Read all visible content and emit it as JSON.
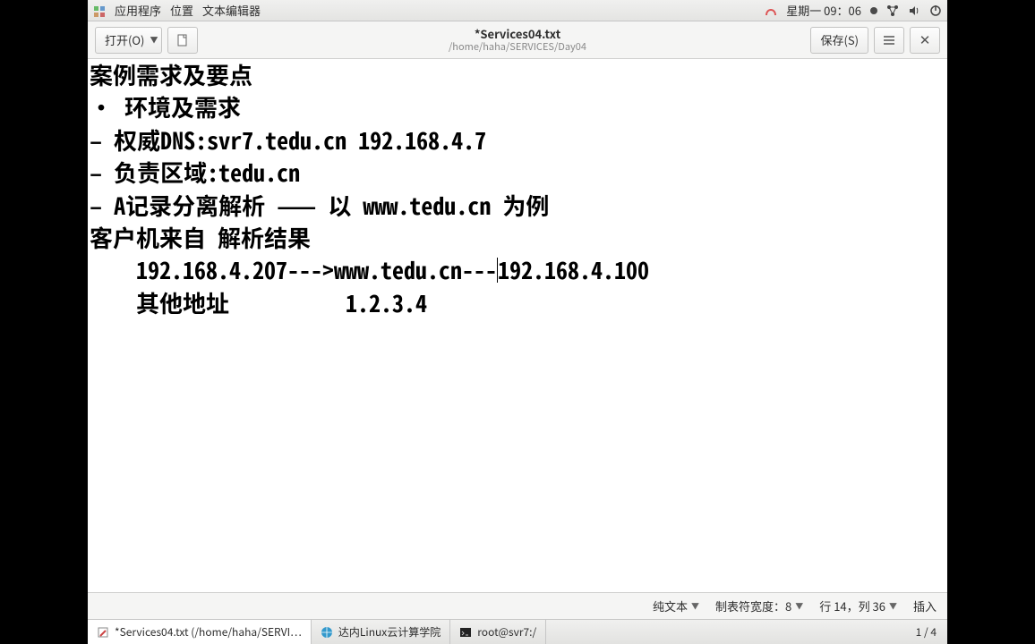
{
  "topbar": {
    "menu_apps": "应用程序",
    "menu_places": "位置",
    "menu_editor": "文本编辑器",
    "clock": "星期一 09：06",
    "icons": {
      "sogou": "sogou-icon",
      "network": "network-icon",
      "volume": "volume-icon",
      "power": "power-icon"
    }
  },
  "toolbar": {
    "open_label": "打开(O)",
    "save_label": "保存(S)",
    "title": "*Services04.txt",
    "path": "/home/haha/SERVICES/Day04"
  },
  "editor": {
    "lines": [
      "案例需求及要点",
      "• 环境及需求",
      "– 权威DNS:svr7.tedu.cn 192.168.4.7",
      "– 负责区域:tedu.cn",
      "– A记录分离解析 —— 以 www.tedu.cn 为例",
      "客户机来自 解析结果",
      "    192.168.4.207--->www.tedu.cn---|192.168.4.100",
      "    其他地址          1.2.3.4"
    ]
  },
  "status": {
    "syntax": "纯文本",
    "tabwidth": "制表符宽度：8",
    "position": "行 14，列 36",
    "mode": "插入"
  },
  "taskbar": {
    "t1": "*Services04.txt (/home/haha/SERVI…",
    "t2": "达内Linux云计算学院",
    "t3": "root@svr7:/",
    "pager": "1 / 4"
  }
}
